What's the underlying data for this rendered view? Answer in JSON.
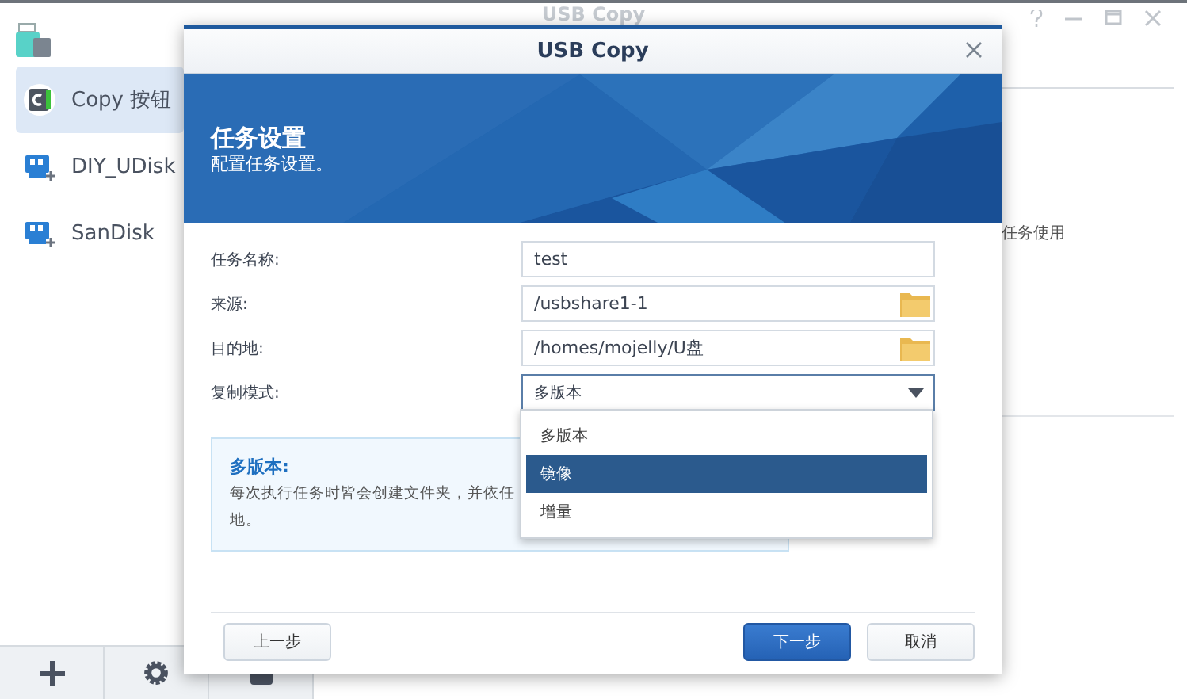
{
  "app": {
    "title": "USB Copy",
    "sidebar": [
      {
        "label": "Copy 按钮",
        "kind": "copy",
        "selected": true
      },
      {
        "label": "DIY_UDisk",
        "kind": "usb",
        "selected": false
      },
      {
        "label": "SanDisk",
        "kind": "usb",
        "selected": false
      }
    ],
    "content_text": "任务使用"
  },
  "dialog": {
    "title": "USB Copy",
    "banner": {
      "title": "任务设置",
      "subtitle": "配置任务设置。"
    },
    "fields": [
      {
        "label": "任务名称:",
        "value": "test",
        "kind": "text"
      },
      {
        "label": "来源:",
        "value": "/usbshare1-1",
        "kind": "folder"
      },
      {
        "label": "目的地:",
        "value": "/homes/mojelly/U盘",
        "kind": "folder"
      },
      {
        "label": "复制模式:",
        "value": "多版本",
        "kind": "select"
      }
    ],
    "info": {
      "title": "多版本:",
      "lines": [
        "每次执行任务时皆会创建文件夹，并依任",
        "地。"
      ]
    },
    "dropdown": [
      {
        "label": "多版本",
        "selected": false
      },
      {
        "label": "镜像",
        "selected": true
      },
      {
        "label": "增量",
        "selected": false
      }
    ],
    "buttons": [
      {
        "label": "上一步",
        "kind": "secondary"
      },
      {
        "label": "下一步",
        "kind": "primary"
      },
      {
        "label": "取消",
        "kind": "secondary"
      }
    ]
  }
}
